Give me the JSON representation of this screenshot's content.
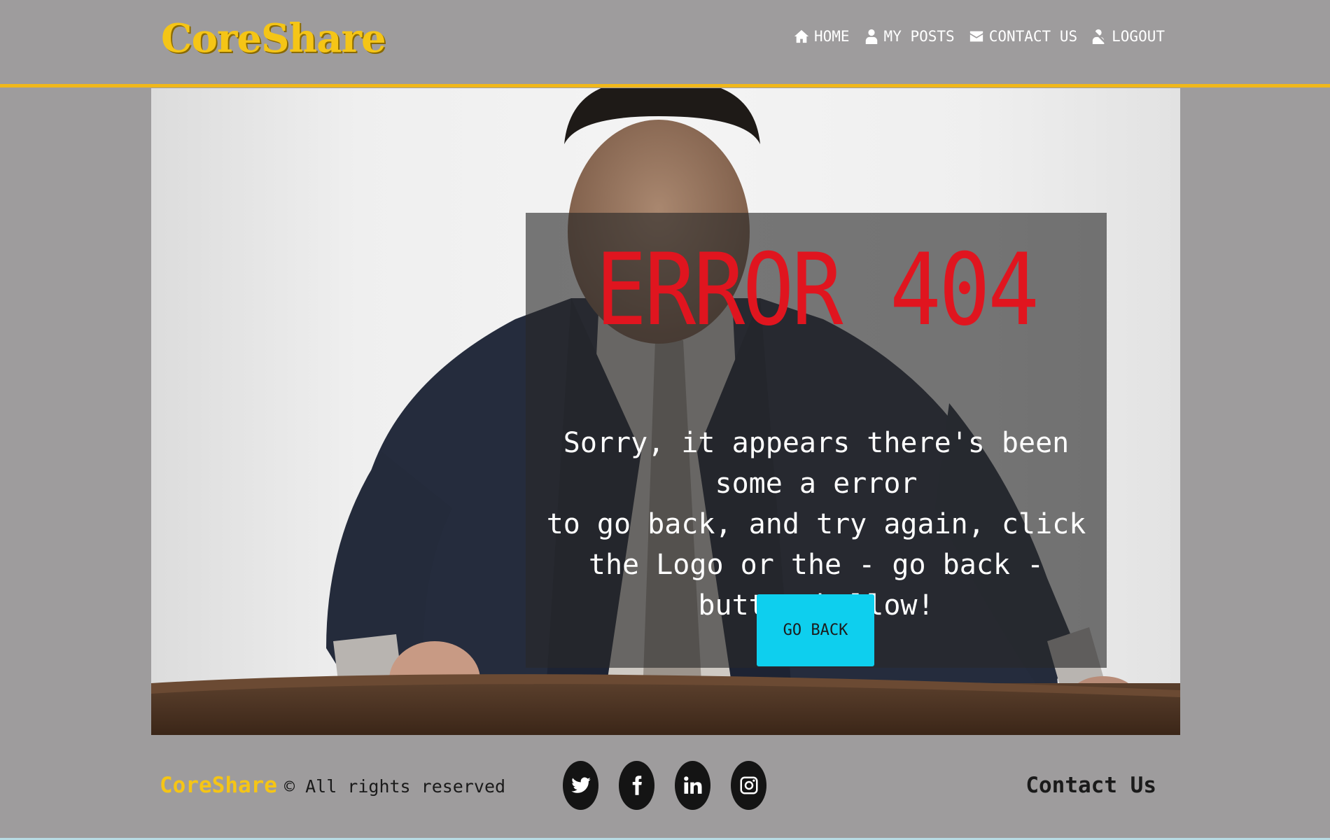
{
  "header": {
    "logo": "CoreShare",
    "nav": [
      {
        "label": "HOME",
        "icon": "home-icon"
      },
      {
        "label": "MY POSTS",
        "icon": "user-icon"
      },
      {
        "label": "CONTACT US",
        "icon": "envelope-icon"
      },
      {
        "label": "LOGOUT",
        "icon": "user-logout-icon"
      }
    ]
  },
  "hero": {
    "title": "ERROR 404",
    "message_line1": "Sorry, it appears there's been some a error",
    "message_line2": "to go back, and try again, click the Logo or the - go back - button bellow!",
    "button_label": "GO BACK"
  },
  "footer": {
    "brand": "CoreShare",
    "copyright": "© All rights reserved",
    "socials": [
      "twitter-icon",
      "facebook-icon",
      "linkedin-icon",
      "instagram-icon"
    ],
    "contact": "Contact Us"
  },
  "colors": {
    "background": "#9e9c9d",
    "accent_gold": "#f5c516",
    "header_border": "#f0b81a",
    "error_red": "#e0151f",
    "button_cyan": "#0ecfee"
  }
}
